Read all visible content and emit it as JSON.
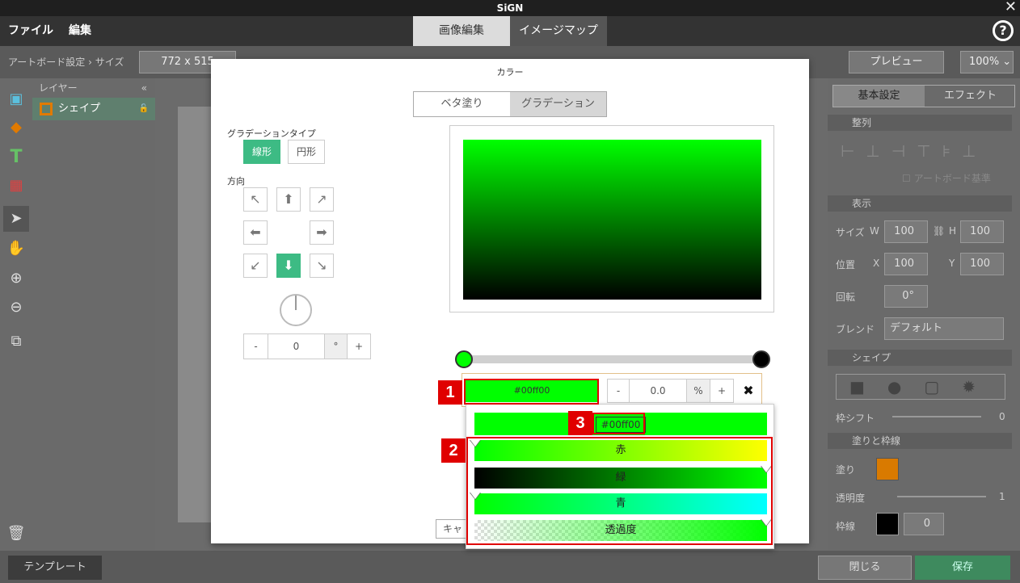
{
  "app": {
    "title": "SiGN"
  },
  "menu": {
    "file": "ファイル",
    "edit": "編集"
  },
  "tabs": {
    "image_edit": "画像編集",
    "image_map": "イメージマップ"
  },
  "toolbar": {
    "breadcrumb": "アートボード設定 › サイズ",
    "size_value": "772 x 515",
    "preview": "プレビュー",
    "zoom": "100%"
  },
  "layers": {
    "header": "レイヤー",
    "collapse": "«",
    "item": "シェイプ"
  },
  "right_panel": {
    "tab_basic": "基本設定",
    "tab_effect": "エフェクト",
    "section_align": "整列",
    "artboard_ref": "アートボード基準",
    "section_display": "表示",
    "size_label": "サイズ",
    "w_label": "W",
    "w_value": "100",
    "h_label": "H",
    "h_value": "100",
    "pos_label": "位置",
    "x_label": "X",
    "x_value": "100",
    "y_label": "Y",
    "y_value": "100",
    "rotate_label": "回転",
    "rotate_value": "0°",
    "blend_label": "ブレンド",
    "blend_value": "デフォルト",
    "section_shape": "シェイプ",
    "frame_shift": "枠シフト",
    "frame_shift_value": "0",
    "section_fill": "塗りと枠線",
    "fill_label": "塗り",
    "fill_color": "#d97a00",
    "opacity_label": "透明度",
    "opacity_value": "1",
    "stroke_label": "枠線",
    "stroke_value": "0"
  },
  "bottom": {
    "template": "テンプレート",
    "close": "閉じる",
    "save": "保存"
  },
  "color_dialog": {
    "title": "カラー",
    "solid": "ベタ塗り",
    "gradient": "グラデーション",
    "gradient_type_label": "グラデーションタイプ",
    "linear": "線形",
    "radial": "円形",
    "direction_label": "方向",
    "angle_minus": "-",
    "angle_value": "0",
    "angle_unit": "°",
    "angle_plus": "+",
    "stop_hex": "#00ff00",
    "stop_minus": "-",
    "stop_pos": "0.0",
    "stop_unit": "%",
    "stop_plus": "+",
    "stop_delete": "✖",
    "cancel_partial": "キャ",
    "start_color": "#00ff00",
    "end_color": "#000000"
  },
  "picker": {
    "hex": "#00ff00",
    "red_label": "赤",
    "green_label": "緑",
    "blue_label": "青",
    "alpha_label": "透過度"
  },
  "annotations": {
    "n1": "1",
    "n2": "2",
    "n3": "3"
  }
}
